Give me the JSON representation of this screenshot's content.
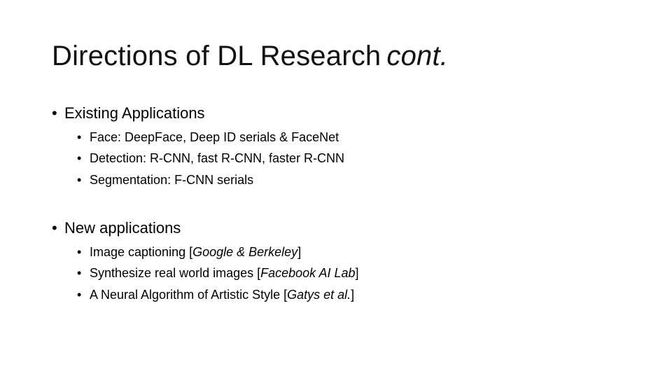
{
  "slide": {
    "title": {
      "main": "Directions of DL Research",
      "suffix": "cont."
    },
    "sections": [
      {
        "heading": "Existing Applications",
        "items": [
          {
            "text": "Face: DeepFace, Deep ID serials  & FaceNet"
          },
          {
            "text": "Detection: R-CNN, fast R-CNN, faster R-CNN"
          },
          {
            "text": "Segmentation: F-CNN serials"
          }
        ]
      },
      {
        "heading": "New applications",
        "items": [
          {
            "text": "Image captioning  [",
            "source": "Google & Berkeley",
            "close": "]"
          },
          {
            "text": "Synthesize real world images [",
            "source": "Facebook AI Lab",
            "close": "]"
          },
          {
            "text": "A Neural Algorithm of Artistic Style [",
            "source": "Gatys et al.",
            "close": "]"
          }
        ]
      }
    ],
    "bullet_glyph": "•"
  }
}
